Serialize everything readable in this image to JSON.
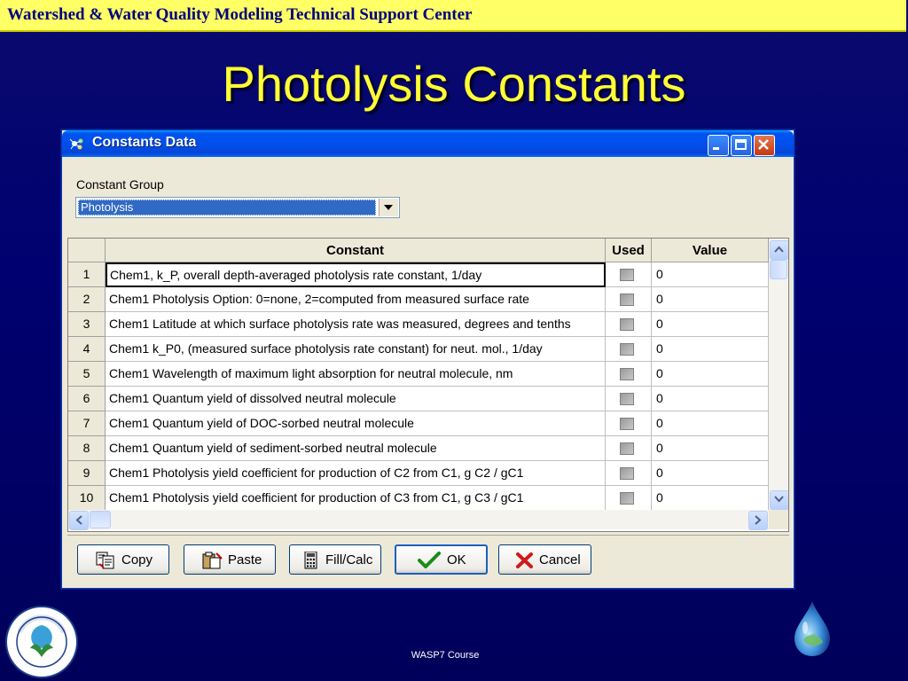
{
  "slide": {
    "banner": "Watershed & Water Quality Modeling Technical Support Center",
    "title": "Photolysis Constants",
    "footer": "WASP7 Course",
    "logo_text": "UNITED STATES ENVIRONMENTAL PROTECTION AGENCY"
  },
  "window": {
    "title": "Constants Data",
    "constant_group_label": "Constant Group",
    "constant_group_value": "Photolysis"
  },
  "grid": {
    "columns": [
      "",
      "Constant",
      "Used",
      "Value"
    ],
    "rows": [
      {
        "num": "1",
        "constant": "Chem1, k_P, overall depth-averaged photolysis rate constant, 1/day",
        "used": false,
        "value": "0"
      },
      {
        "num": "2",
        "constant": "Chem1 Photolysis Option: 0=none, 2=computed from measured surface rate",
        "used": false,
        "value": "0"
      },
      {
        "num": "3",
        "constant": "Chem1 Latitude at which surface photolysis rate was measured, degrees and tenths",
        "used": false,
        "value": "0"
      },
      {
        "num": "4",
        "constant": "Chem1 k_P0, (measured surface photolysis rate constant) for neut. mol., 1/day",
        "used": false,
        "value": "0"
      },
      {
        "num": "5",
        "constant": "Chem1 Wavelength of maximum light absorption for neutral molecule, nm",
        "used": false,
        "value": "0"
      },
      {
        "num": "6",
        "constant": "Chem1 Quantum yield of dissolved neutral molecule",
        "used": false,
        "value": "0"
      },
      {
        "num": "7",
        "constant": "Chem1 Quantum yield of DOC-sorbed neutral molecule",
        "used": false,
        "value": "0"
      },
      {
        "num": "8",
        "constant": "Chem1 Quantum yield of sediment-sorbed neutral molecule",
        "used": false,
        "value": "0"
      },
      {
        "num": "9",
        "constant": "Chem1 Photolysis yield coefficient for production of C2 from C1, g C2 / gC1",
        "used": false,
        "value": "0"
      },
      {
        "num": "10",
        "constant": "Chem1 Photolysis yield coefficient for production of C3 from C1, g C3 / gC1",
        "used": false,
        "value": "0"
      }
    ]
  },
  "buttons": {
    "copy": "Copy",
    "paste": "Paste",
    "fillcalc": "Fill/Calc",
    "ok": "OK",
    "cancel": "Cancel"
  },
  "colors": {
    "background": "#000070",
    "banner": "#ffff66",
    "title": "#ffff33",
    "window_titlebar": "#0053ee",
    "selection": "#316ac5"
  }
}
